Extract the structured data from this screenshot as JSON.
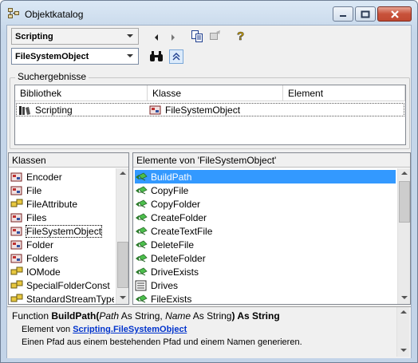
{
  "window": {
    "title": "Objektkatalog"
  },
  "toolbar": {
    "library_combo": "Scripting",
    "search_combo": "FileSystemObject"
  },
  "search_results": {
    "group_label": "Suchergebnisse",
    "columns": [
      "Bibliothek",
      "Klasse",
      "Element"
    ],
    "rows": [
      {
        "library": "Scripting",
        "class": "FileSystemObject",
        "element": ""
      }
    ]
  },
  "classes": {
    "header": "Klassen",
    "items": [
      "Encoder",
      "File",
      "FileAttribute",
      "Files",
      "FileSystemObject",
      "Folder",
      "Folders",
      "IOMode",
      "SpecialFolderConst",
      "StandardStreamType"
    ],
    "selected": "FileSystemObject"
  },
  "members": {
    "header": "Elemente von 'FileSystemObject'",
    "items": [
      "BuildPath",
      "CopyFile",
      "CopyFolder",
      "CreateFolder",
      "CreateTextFile",
      "DeleteFile",
      "DeleteFolder",
      "DriveExists",
      "Drives",
      "FileExists"
    ],
    "selected": "BuildPath"
  },
  "details": {
    "prefix": "Function ",
    "name": "BuildPath",
    "open_paren": "(",
    "param1": "Path",
    "as1": " As String, ",
    "param2": "Name",
    "as2": " As String",
    "close": ") As String",
    "member_of": "Element von ",
    "lib_link": "Scripting",
    "dot": ".",
    "class_link": "FileSystemObject",
    "description": "Einen Pfad aus einem bestehenden Pfad und einem Namen generieren."
  },
  "icons": {
    "app": "object-browser-icon",
    "back": "back-arrow-icon",
    "forward": "forward-arrow-icon",
    "copy": "copy-icon",
    "view_definition": "view-definition-icon",
    "help": "help-icon",
    "search": "binoculars-icon",
    "toggle": "collapse-icon"
  },
  "colors": {
    "selection": "#3399ff",
    "link": "#0033cc"
  }
}
